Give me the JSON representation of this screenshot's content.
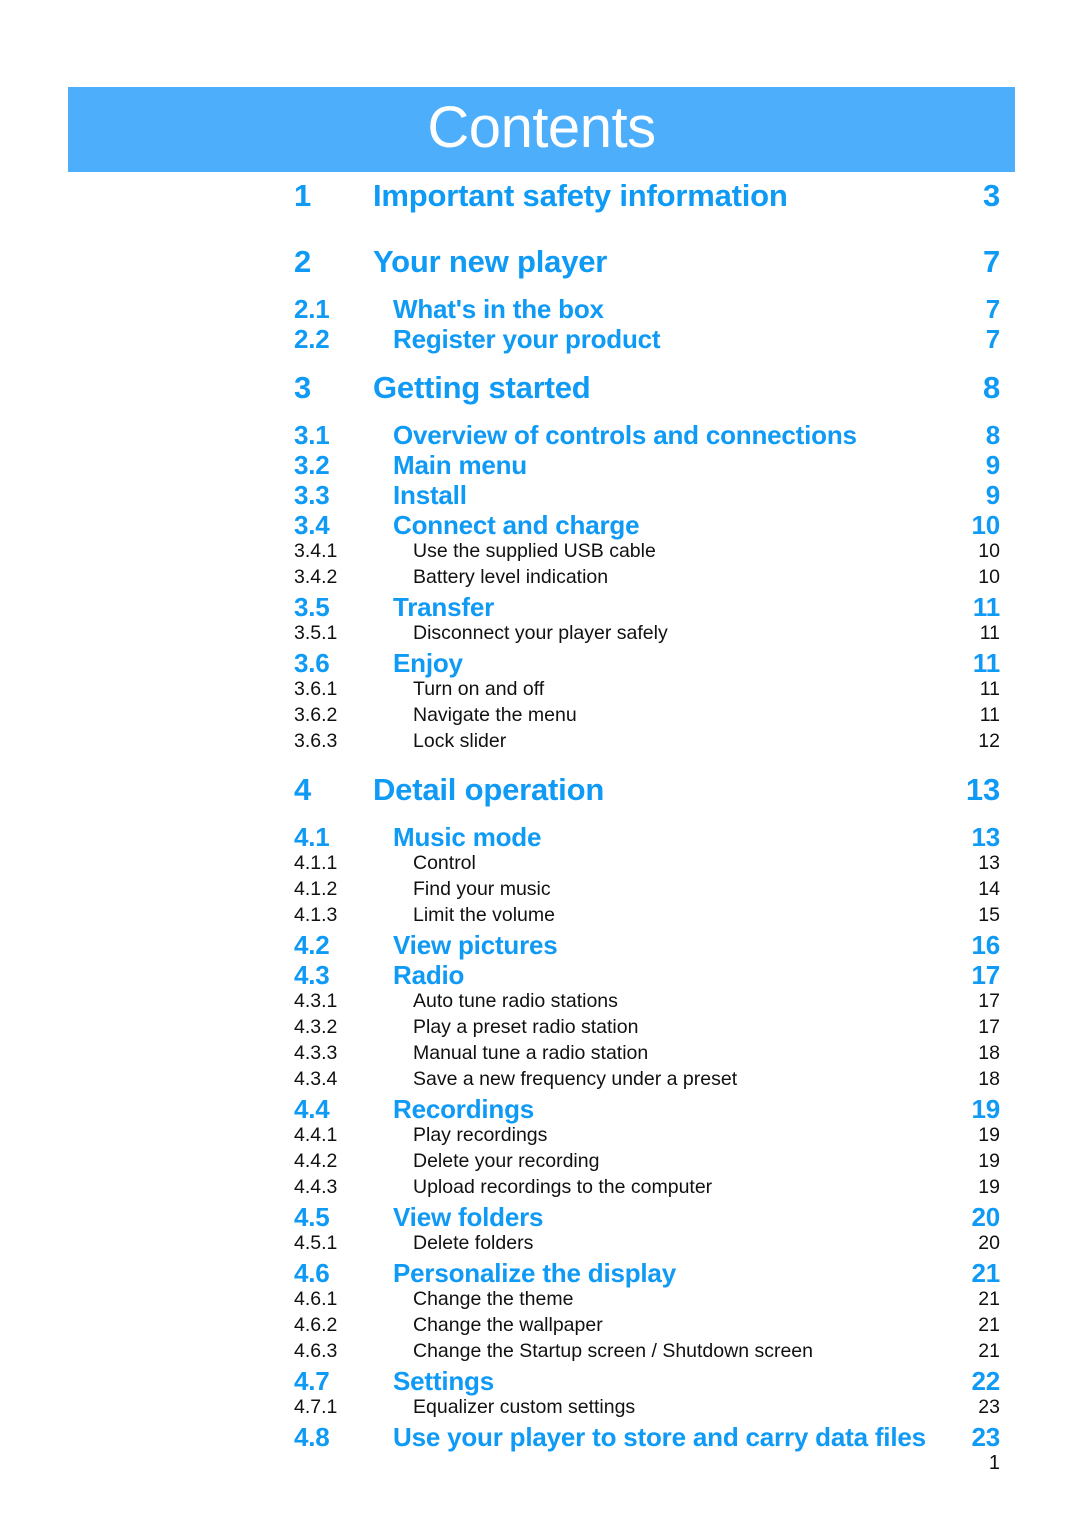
{
  "banner": {
    "title": "Contents",
    "background_color": "#4daefb",
    "text_color": "#ffffff"
  },
  "colors": {
    "accent_blue": "#0e9af5",
    "banner_blue": "#4daefb",
    "body_black": "#111111"
  },
  "footer": {
    "page_number": "1"
  },
  "toc": {
    "entries": [
      {
        "level": 1,
        "number": "1",
        "title": "Important safety information",
        "page": "3"
      },
      {
        "level": 1,
        "number": "2",
        "title": "Your new player",
        "page": "7"
      },
      {
        "level": 2,
        "number": "2.1",
        "title": "What's in the box",
        "page": "7"
      },
      {
        "level": 2,
        "number": "2.2",
        "title": "Register your product",
        "page": "7"
      },
      {
        "level": 1,
        "number": "3",
        "title": "Getting started",
        "page": "8"
      },
      {
        "level": 2,
        "number": "3.1",
        "title": "Overview of controls and connections",
        "page": "8"
      },
      {
        "level": 2,
        "number": "3.2",
        "title": "Main menu",
        "page": "9"
      },
      {
        "level": 2,
        "number": "3.3",
        "title": "Install",
        "page": "9"
      },
      {
        "level": 2,
        "number": "3.4",
        "title": "Connect and charge",
        "page": "10"
      },
      {
        "level": 3,
        "number": "3.4.1",
        "title": "Use the supplied USB cable",
        "page": "10"
      },
      {
        "level": 3,
        "number": "3.4.2",
        "title": "Battery level indication",
        "page": "10"
      },
      {
        "level": 2,
        "number": "3.5",
        "title": "Transfer",
        "page": "11"
      },
      {
        "level": 3,
        "number": "3.5.1",
        "title": "Disconnect your player safely",
        "page": "11"
      },
      {
        "level": 2,
        "number": "3.6",
        "title": "Enjoy",
        "page": "11"
      },
      {
        "level": 3,
        "number": "3.6.1",
        "title": "Turn on and off",
        "page": "11"
      },
      {
        "level": 3,
        "number": "3.6.2",
        "title": "Navigate the menu",
        "page": "11"
      },
      {
        "level": 3,
        "number": "3.6.3",
        "title": "Lock slider",
        "page": "12"
      },
      {
        "level": 1,
        "number": "4",
        "title": "Detail operation",
        "page": "13"
      },
      {
        "level": 2,
        "number": "4.1",
        "title": "Music mode",
        "page": "13"
      },
      {
        "level": 3,
        "number": "4.1.1",
        "title": "Control",
        "page": "13"
      },
      {
        "level": 3,
        "number": "4.1.2",
        "title": "Find your music",
        "page": "14"
      },
      {
        "level": 3,
        "number": "4.1.3",
        "title": "Limit the volume",
        "page": "15"
      },
      {
        "level": 2,
        "number": "4.2",
        "title": "View pictures",
        "page": "16"
      },
      {
        "level": 2,
        "number": "4.3",
        "title": "Radio",
        "page": "17"
      },
      {
        "level": 3,
        "number": "4.3.1",
        "title": "Auto tune radio stations",
        "page": "17"
      },
      {
        "level": 3,
        "number": "4.3.2",
        "title": "Play a preset radio station",
        "page": "17"
      },
      {
        "level": 3,
        "number": "4.3.3",
        "title": "Manual tune a radio station",
        "page": "18"
      },
      {
        "level": 3,
        "number": "4.3.4",
        "title": "Save a new frequency under a preset",
        "page": "18"
      },
      {
        "level": 2,
        "number": "4.4",
        "title": "Recordings",
        "page": "19"
      },
      {
        "level": 3,
        "number": "4.4.1",
        "title": "Play recordings",
        "page": "19"
      },
      {
        "level": 3,
        "number": "4.4.2",
        "title": "Delete your recording",
        "page": "19"
      },
      {
        "level": 3,
        "number": "4.4.3",
        "title": "Upload recordings to the computer",
        "page": "19"
      },
      {
        "level": 2,
        "number": "4.5",
        "title": "View folders",
        "page": "20"
      },
      {
        "level": 3,
        "number": "4.5.1",
        "title": "Delete folders",
        "page": "20"
      },
      {
        "level": 2,
        "number": "4.6",
        "title": "Personalize the display",
        "page": "21"
      },
      {
        "level": 3,
        "number": "4.6.1",
        "title": "Change the theme",
        "page": "21"
      },
      {
        "level": 3,
        "number": "4.6.2",
        "title": "Change the wallpaper",
        "page": "21"
      },
      {
        "level": 3,
        "number": "4.6.3",
        "title": "Change the Startup screen / Shutdown screen",
        "page": "21"
      },
      {
        "level": 2,
        "number": "4.7",
        "title": "Settings",
        "page": "22"
      },
      {
        "level": 3,
        "number": "4.7.1",
        "title": "Equalizer custom settings",
        "page": "23"
      },
      {
        "level": 2,
        "number": "4.8",
        "title": "Use your player to store and carry data files",
        "page": "23"
      }
    ]
  }
}
